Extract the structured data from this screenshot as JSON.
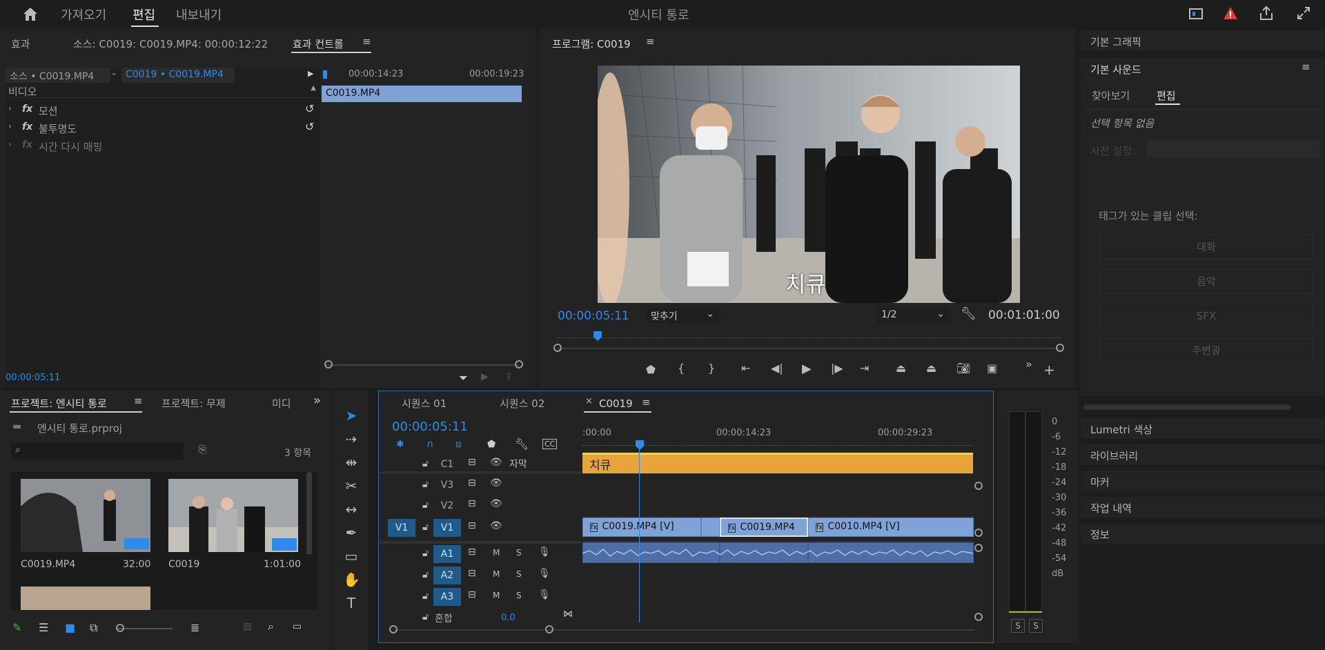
{
  "topbar": {
    "home": "home-icon",
    "tabs": [
      "가져오기",
      "편집",
      "내보내기"
    ],
    "title": "엔시티 통로"
  },
  "effect_controls": {
    "tab_effects": "효과",
    "tab_source": "소스: C0019: C0019.MP4: 00:00:12:22",
    "tab_effect_controls": "효과 컨트롤",
    "source_select": "소스 • C0019.MP4",
    "sequence_select": "C0019 • C0019.MP4",
    "time1": "00:00:14:23",
    "time2": "00:00:19:23",
    "clip": "C0019.MP4",
    "section": "비디오",
    "effects": [
      "모션",
      "불투명도",
      "시간 다시 매핑"
    ],
    "fx": "fx",
    "timecode": "00:00:05:11"
  },
  "program": {
    "title": "프로그램: C0019",
    "subtitle": "치큐",
    "timecode": "00:00:05:11",
    "fit": "맞추기",
    "quality": "1/2",
    "duration": "00:01:01:00"
  },
  "right_panel": {
    "essential_graphics": "기본 그래픽",
    "essential_sound": "기본 사운드",
    "tab_browse": "찾아보기",
    "tab_edit": "편집",
    "no_selection": "선택 항목 없음",
    "preset": "사전 설정:",
    "tag_label": "태그가 있는 클립 선택:",
    "buttons": [
      "대화",
      "음악",
      "SFX",
      "주변광"
    ],
    "sections": [
      "Lumetri 색상",
      "라이브러리",
      "마커",
      "작업 내역",
      "정보"
    ]
  },
  "project": {
    "tab1": "프로젝트: 엔시티 통로",
    "tab2": "프로젝트: 무제",
    "tab3": "미디",
    "file": "엔시티 통로.prproj",
    "search_placeholder": "",
    "count": "3 항목",
    "items": [
      {
        "name": "C0019.MP4",
        "duration": "32:00"
      },
      {
        "name": "C0019",
        "duration": "1:01:00"
      }
    ]
  },
  "timeline": {
    "tabs": [
      "시퀀스 01",
      "시퀀스 02",
      "C0019"
    ],
    "timecode": "00:00:05:11",
    "ruler": [
      ":00:00",
      "00:00:14:23",
      "00:00:29:23"
    ],
    "tracks": [
      {
        "id": "C1",
        "name": "자막"
      },
      {
        "id": "V3",
        "name": ""
      },
      {
        "id": "V2",
        "name": ""
      },
      {
        "id": "V1",
        "name": ""
      },
      {
        "id": "A1",
        "name": ""
      },
      {
        "id": "A2",
        "name": ""
      },
      {
        "id": "A3",
        "name": ""
      }
    ],
    "source_patch": "V1",
    "mix_label": "혼합",
    "mix_value": "0.0",
    "caption_clip": "치큐",
    "video_clips": [
      "C0019.MP4 [V]",
      "C0019.MP4",
      "C0010.MP4 [V]"
    ],
    "m": "M",
    "s": "S"
  },
  "meter": {
    "scale": [
      "0",
      "-6",
      "-12",
      "-18",
      "-24",
      "-30",
      "-36",
      "-42",
      "-48",
      "-54",
      "dB"
    ],
    "solo": "S"
  },
  "colors": {
    "accent": "#2d8ceb",
    "caption": "#e9a33b",
    "video_clip": "#7fa3d6",
    "audio_clip": "#4f6ea5",
    "alert": "#e03a3a"
  }
}
